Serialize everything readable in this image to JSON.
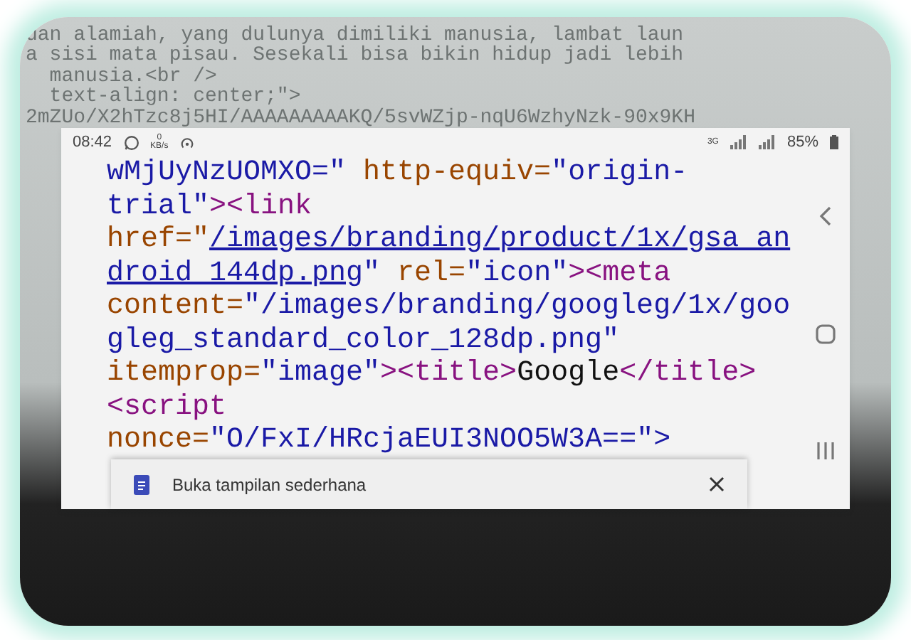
{
  "background_lines": [
    "uan alamiah, yang dulunya dimiliki manusia, lambat laun",
    "a sisi mata pisau. Sesekali bisa bikin hidup jadi lebih",
    "  manusia.<br />",
    "  text-align: center;\">",
    "2mZUo/X2hTzc8j5HI/AAAAAAAAAKQ/5svWZjp-nqU6WzhyNzk-90x9KH"
  ],
  "status_bar": {
    "time": "08:42",
    "data_speed": "0",
    "data_unit": "KB/s",
    "network": "3G",
    "battery": "85%"
  },
  "code_lines": [
    [
      {
        "kind": "value",
        "text": "wMjUyNzUOMXO=\""
      },
      {
        "kind": "attr",
        "text": " http-equiv="
      },
      {
        "kind": "value",
        "text": "\"origin-"
      }
    ],
    [
      {
        "kind": "value",
        "text": "trial\""
      },
      {
        "kind": "tag",
        "text": "><link"
      }
    ],
    [
      {
        "kind": "attr",
        "text": "href=\""
      },
      {
        "kind": "link",
        "text": "/images/branding/product/1x/gsa_an"
      }
    ],
    [
      {
        "kind": "link",
        "text": "droid_144dp.png"
      },
      {
        "kind": "value",
        "text": "\""
      },
      {
        "kind": "attr",
        "text": " rel="
      },
      {
        "kind": "value",
        "text": "\"icon\""
      },
      {
        "kind": "tag",
        "text": "><meta"
      }
    ],
    [
      {
        "kind": "attr",
        "text": "content="
      },
      {
        "kind": "value",
        "text": "\"/images/branding/googleg/1x/goo"
      }
    ],
    [
      {
        "kind": "value",
        "text": "gleg_standard_color_128dp.png\""
      }
    ],
    [
      {
        "kind": "attr",
        "text": "itemprop="
      },
      {
        "kind": "value",
        "text": "\"image\""
      },
      {
        "kind": "tag",
        "text": "><title>"
      },
      {
        "kind": "text",
        "text": "Google"
      },
      {
        "kind": "tag",
        "text": "</title>"
      }
    ],
    [
      {
        "kind": "tag",
        "text": "<script"
      }
    ],
    [
      {
        "kind": "attr",
        "text": "nonce="
      },
      {
        "kind": "value",
        "text": "\"O/FxI/HRcjaEUI3NOO5W3A==\">"
      }
    ]
  ],
  "toast": {
    "label": "Buka tampilan sederhana"
  }
}
